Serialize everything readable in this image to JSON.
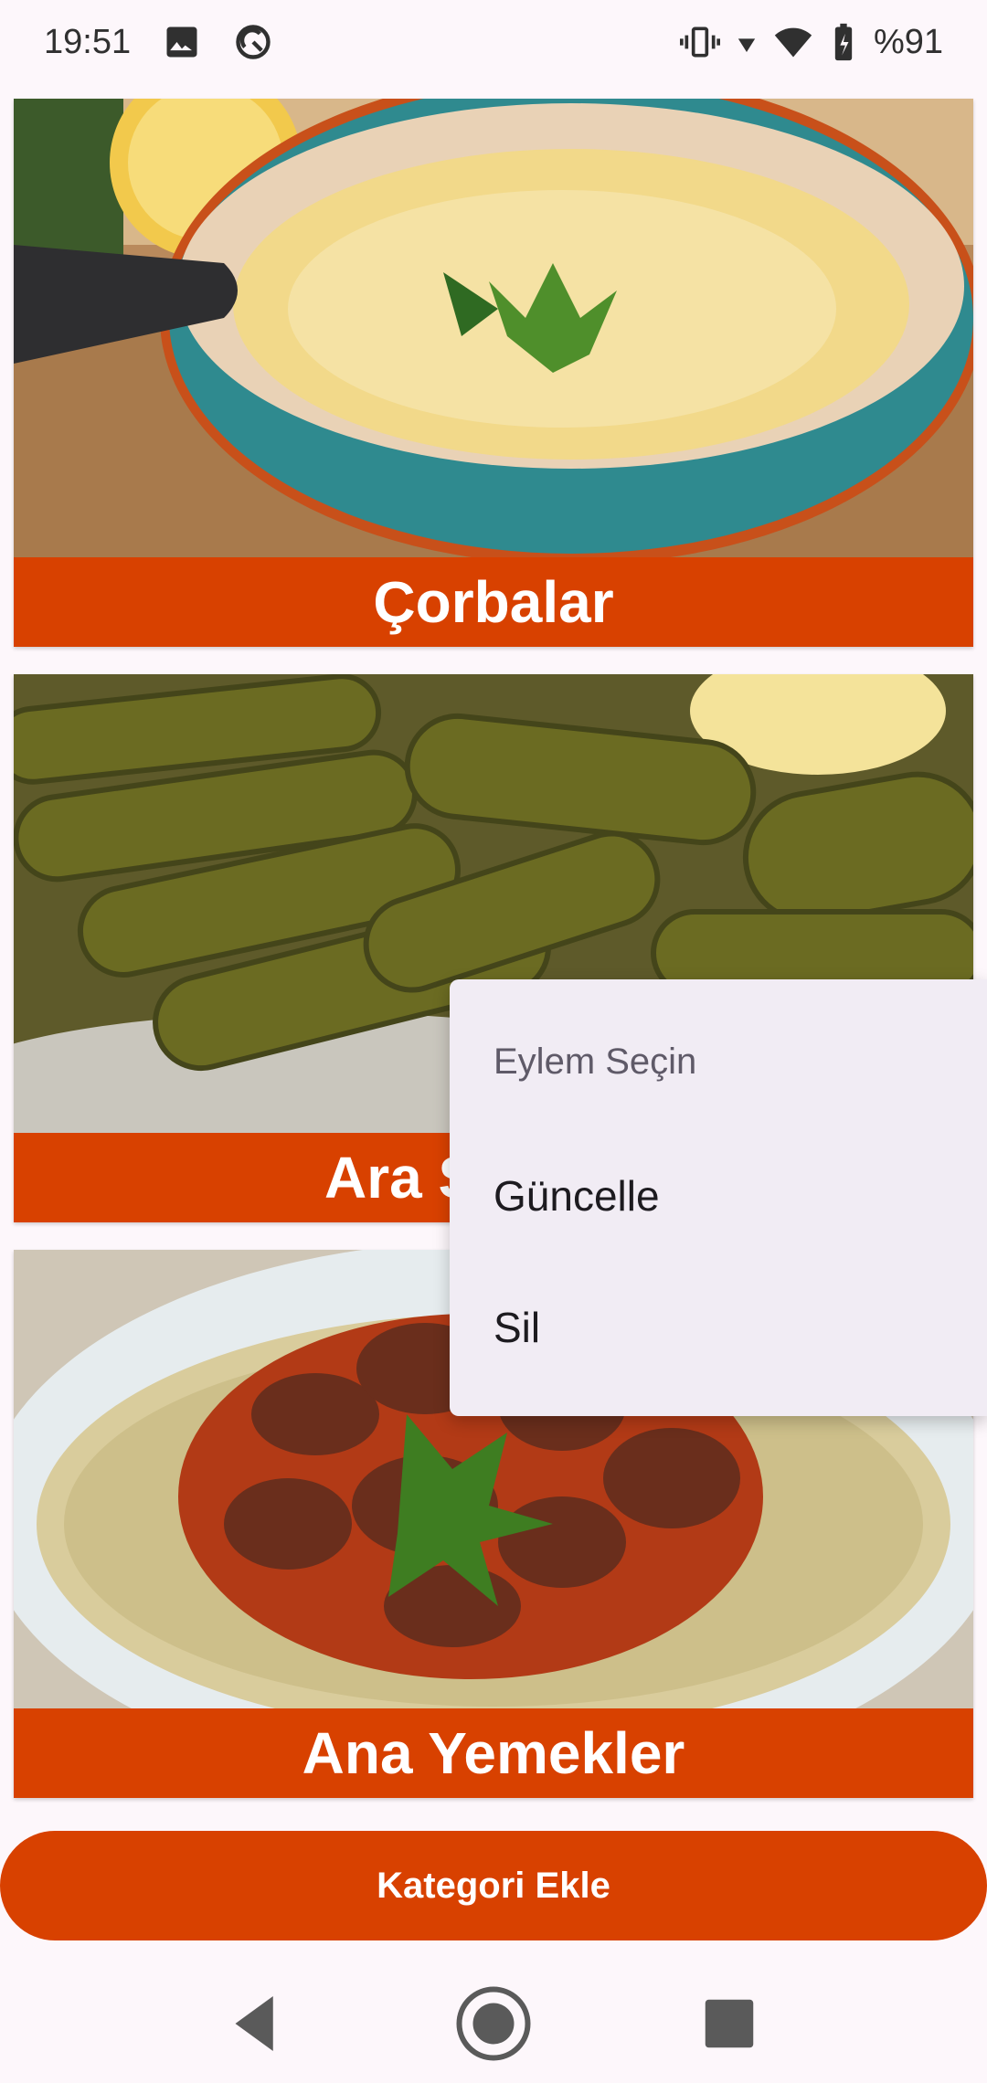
{
  "status_bar": {
    "time": "19:51",
    "battery": "%91",
    "icons": [
      "image-icon",
      "sync-icon",
      "vibrate-icon",
      "signal-icon",
      "wifi-icon",
      "battery-icon"
    ]
  },
  "categories": [
    {
      "label": "Çorbalar",
      "image": "soup-bowl-photo"
    },
    {
      "label": "Ara Sıcaklar",
      "image": "stuffed-grape-leaves-photo"
    },
    {
      "label": "Ana Yemekler",
      "image": "meat-stew-on-puree-photo"
    }
  ],
  "popup_menu": {
    "title": "Eylem Seçin",
    "items": [
      "Güncelle",
      "Sil"
    ]
  },
  "add_button": {
    "label": "Kategori Ekle"
  },
  "nav_bar": {
    "icons": [
      "back-icon",
      "home-icon",
      "recents-icon"
    ]
  },
  "colors": {
    "accent": "#d84100",
    "menu_bg": "#f1ecf4",
    "background": "#fdf7fb"
  }
}
